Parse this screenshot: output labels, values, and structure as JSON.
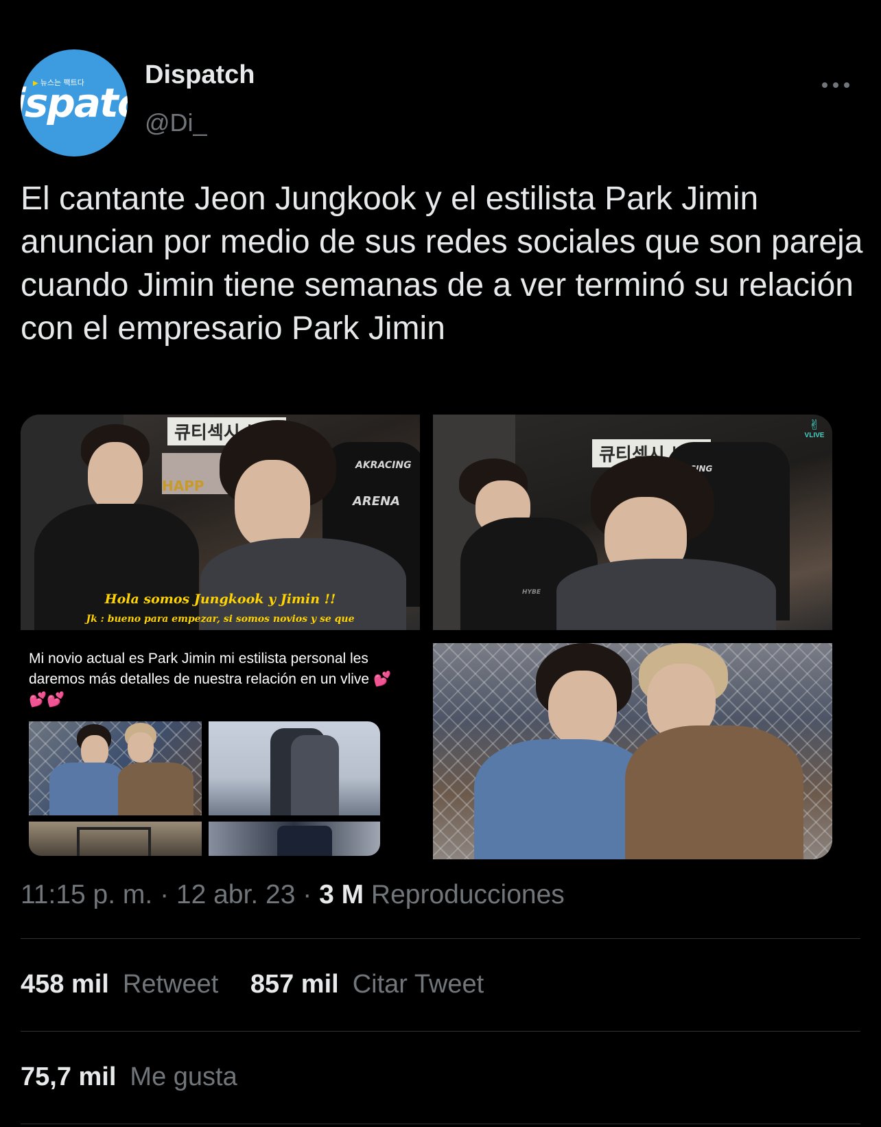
{
  "tweet": {
    "author": {
      "avatar_text": "ispatc",
      "avatar_tag": "뉴스는 팩트다",
      "display_name": "Dispatch",
      "handle": "@Di_"
    },
    "text": "El cantante Jeon Jungkook y el estilista Park Jimin anuncian por medio de sus redes sociales que son pareja cuando Jimin tiene semanas de a ver terminó su relación con el empresario Park Jimin",
    "media": {
      "panel_1": {
        "sign": "큐티섹시 브리",
        "chair_brand": "AKRACING",
        "chair_series": "ARENA",
        "sticker": "HAPP",
        "caption_main": "Hola somos Jungkook y Jimin !!",
        "caption_sub": "Jk : bueno para empezar, si somos novios y se que"
      },
      "panel_2": {
        "sign": "큐티섹시 브리",
        "chair_brand": "RACING",
        "badge": "VLIVE",
        "shirt_logo": "HYBE"
      },
      "panel_3": {
        "text": "Mi novio actual es Park Jimin mi estilista personal les daremos más detalles de nuestra relación en un vlive 💕💕💕"
      }
    },
    "meta": {
      "time": "11:15 p. m.",
      "date": "12 abr. 23",
      "views_count": "3 M",
      "views_label": "Reproducciones"
    },
    "stats": {
      "retweets_count": "458 mil",
      "retweets_label": "Retweet",
      "quotes_count": "857 mil",
      "quotes_label": "Citar Tweet",
      "likes_count": "75,7 mil",
      "likes_label": "Me gusta"
    }
  },
  "icons": {
    "more": "more-icon",
    "vlive": "vlive-icon"
  },
  "colors": {
    "background": "#000000",
    "primary_text": "#e7e9ea",
    "secondary_text": "#71767b",
    "divider": "#2f3336",
    "avatar_bg": "#3d9be0",
    "caption_yellow": "#ffd400"
  }
}
